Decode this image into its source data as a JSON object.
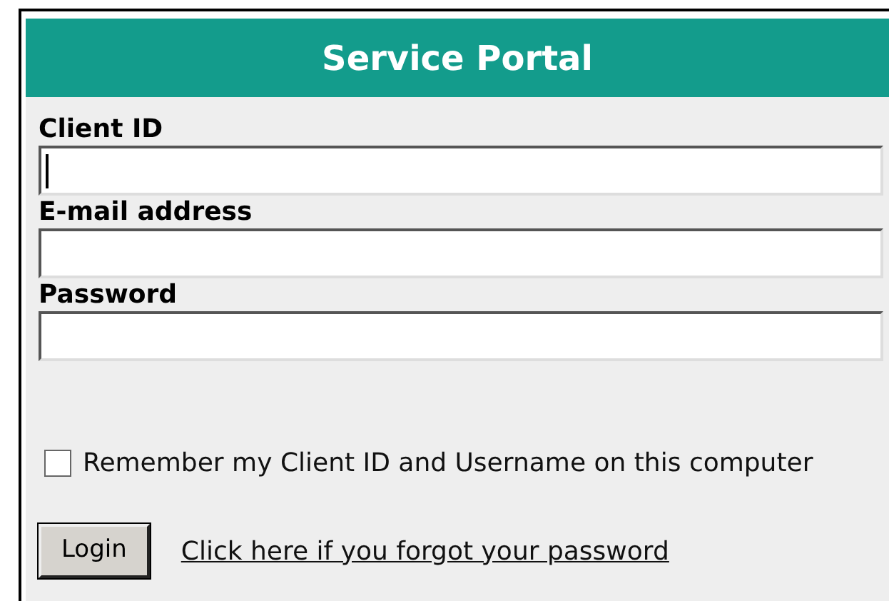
{
  "title": "Service Portal",
  "fields": [
    {
      "label": "Client ID",
      "focused": true
    },
    {
      "label": "E-mail address",
      "focused": false
    },
    {
      "label": "Password",
      "focused": false
    }
  ],
  "remember": {
    "label": "Remember my Client ID and Username on this computer",
    "checked": false
  },
  "login_button": "Login",
  "forgot_link": "Click here if you forgot your password"
}
